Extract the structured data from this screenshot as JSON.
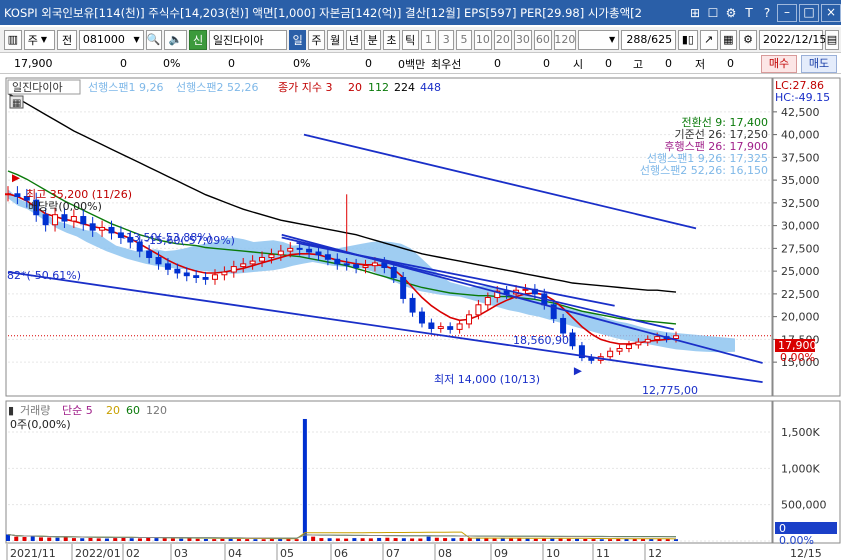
{
  "window": {
    "title": "KOSPI 외국인보유[114(천)] 주식수[14,203(천)] 액면[1,000] 자본금[142(억)] 결산[12월] EPS[597] PER[29.98] 시가총액[2",
    "buttons": [
      "⊞",
      "☐",
      "⚙",
      "T",
      "?",
      "–",
      "□",
      "×"
    ]
  },
  "toolbar": {
    "period_select": "주",
    "prev_label": "전",
    "stock_code": "081000",
    "stock_name": "일진다이아",
    "period_tabs": [
      "일",
      "주",
      "월",
      "년",
      "분",
      "초",
      "틱"
    ],
    "active_tab": "일",
    "intervals": [
      "1",
      "3",
      "5",
      "10",
      "20",
      "30",
      "60",
      "120"
    ],
    "count": "288/625",
    "date": "2022/12/15"
  },
  "quote": {
    "price": "17,900",
    "change": "0",
    "change_pct": "0%",
    "volume": "0",
    "volume_pct": "0%",
    "amount": "0",
    "amount_pct": "0%",
    "value": "0백만",
    "priority_label": "최우선",
    "ask": "0",
    "bid": "0",
    "open_label": "시",
    "open": "0",
    "high_label": "고",
    "high": "0",
    "low_label": "저",
    "low": "0",
    "buy_label": "매수",
    "sell_label": "매도"
  },
  "colors": {
    "up": "#e00000",
    "down": "#0030d0",
    "cloud": "#8ec4f0",
    "ma_black": "#000000",
    "ma_green": "#0a7a0a",
    "trend": "#1a2fc8"
  },
  "chart_data": {
    "type": "candlestick",
    "price_panel": {
      "name_label": "일진다이아",
      "legend": [
        {
          "text": "선행스팬1 9,26",
          "color": "#7fb8e8"
        },
        {
          "text": "선행스팬2 52,26",
          "color": "#7fb8e8"
        },
        {
          "text": "종가 지수 3",
          "color": "#c00000"
        },
        {
          "text": "20",
          "color": "#c00000"
        },
        {
          "text": "112",
          "color": "#0a7a0a"
        },
        {
          "text": "224",
          "color": "#000000"
        },
        {
          "text": "448",
          "color": "#1a2fc8"
        }
      ],
      "lc_label": "LC:27.86",
      "hc_label": "HC:-49.15",
      "ylim": [
        11500,
        46000
      ],
      "y_ticks": [
        "42,500",
        "40,000",
        "37,500",
        "35,000",
        "32,500",
        "30,000",
        "27,500",
        "25,000",
        "22,500",
        "20,000",
        "17,500",
        "15,000"
      ],
      "y_tick_values": [
        42500,
        40000,
        37500,
        35000,
        32500,
        30000,
        27500,
        25000,
        22500,
        20000,
        17500,
        15000
      ],
      "current_price_label": "17,900",
      "current_change_label": "0.00%",
      "current_price": 17900,
      "ichimoku_values": [
        {
          "label": "전환선 9: 17,400",
          "color": "#0a7a0a"
        },
        {
          "label": "기준선 26: 17,250",
          "color": "#333333"
        },
        {
          "label": "후행스팬 26: 17,900",
          "color": "#a0208a"
        },
        {
          "label": "선행스팬1 9,26: 17,325",
          "color": "#7fb8e8"
        },
        {
          "label": "선행스팬2 52,26: 16,150",
          "color": "#7fb8e8"
        }
      ],
      "annotations": {
        "high": "최고 35,200 (11/26)",
        "high_value": 35200,
        "dividend": "배당락(0,00%)",
        "low": "최저 14,000 (10/13)",
        "low_value": 14000,
        "left_pct": "82*(-50,61%)",
        "fall_1": "-13,50(-53,88%)",
        "fall_2": "-15,60(-57,09%)",
        "mid_value": "18,560,90",
        "channel_end": "12,775,00"
      },
      "close_series": [
        33500,
        33200,
        32800,
        31200,
        30100,
        31200,
        30500,
        31000,
        30200,
        29500,
        29800,
        29200,
        28700,
        28200,
        27200,
        26500,
        25800,
        25200,
        24800,
        24500,
        24300,
        24100,
        24600,
        24900,
        25500,
        25800,
        26100,
        26500,
        26800,
        27200,
        27500,
        27400,
        27100,
        26800,
        26300,
        25800,
        25700,
        25400,
        25600,
        25900,
        25400,
        24300,
        22000,
        20500,
        19300,
        18700,
        18900,
        18600,
        19200,
        20200,
        21300,
        22100,
        22800,
        22500,
        22900,
        23000,
        22500,
        21300,
        19800,
        18200,
        16800,
        15500,
        15200,
        15600,
        16200,
        16500,
        16900,
        17200,
        17500,
        17800,
        17600,
        17900
      ],
      "ma20": [
        33500,
        33200,
        32700,
        32000,
        31300,
        31000,
        30700,
        30500,
        30200,
        29900,
        29700,
        29400,
        29000,
        28600,
        28000,
        27400,
        26800,
        26200,
        25700,
        25300,
        25000,
        24800,
        24800,
        24900,
        25100,
        25300,
        25600,
        25900,
        26200,
        26500,
        26800,
        26900,
        26900,
        26800,
        26500,
        26200,
        26000,
        25800,
        25700,
        25700,
        25600,
        25200,
        24300,
        23200,
        22100,
        21200,
        20500,
        19900,
        19600,
        19700,
        20100,
        20700,
        21300,
        21800,
        22200,
        22500,
        22600,
        22400,
        21800,
        20900,
        19900,
        18900,
        18100,
        17500,
        17200,
        17000,
        17000,
        17100,
        17300,
        17400,
        17500,
        17600
      ],
      "ma112": [
        36000,
        35600,
        35100,
        34500,
        33900,
        33300,
        32700,
        32200,
        31700,
        31200,
        30700,
        30200,
        29800,
        29400,
        29000,
        28700,
        28400,
        28200,
        28000,
        27900,
        27800,
        27600,
        27500,
        27400,
        27300,
        27200,
        27100,
        27000,
        26900,
        26800,
        26700,
        26600,
        26400,
        26200,
        26000,
        25800,
        25600,
        25300,
        25000,
        24700,
        24400,
        24100,
        23800,
        23500,
        23200,
        23000,
        22800,
        22600,
        22500,
        22400,
        22300,
        22300,
        22200,
        22200,
        22100,
        22000,
        21900,
        21700,
        21500,
        21200,
        20900,
        20600,
        20400,
        20200,
        20000,
        19800,
        19700,
        19600,
        19500,
        19400,
        19300,
        19200
      ],
      "ma224": [
        44500,
        44000,
        43400,
        42800,
        42200,
        41600,
        41000,
        40400,
        39900,
        39400,
        38900,
        38400,
        37900,
        37400,
        36900,
        36400,
        35900,
        35400,
        34900,
        34400,
        33900,
        33400,
        33000,
        32600,
        32200,
        31800,
        31500,
        31200,
        30900,
        30600,
        30400,
        30200,
        30000,
        29800,
        29600,
        29400,
        29200,
        29000,
        28700,
        28400,
        28100,
        27800,
        27500,
        27200,
        26900,
        26700,
        26500,
        26300,
        26100,
        25900,
        25700,
        25500,
        25300,
        25100,
        24900,
        24700,
        24500,
        24300,
        24100,
        23900,
        23700,
        23600,
        23500,
        23400,
        23300,
        23200,
        23100,
        23000,
        22900,
        22900,
        22800,
        22700
      ],
      "cloud_upper": [
        34000,
        33000,
        32500,
        31800,
        31200,
        30500,
        30200,
        29800,
        29500,
        29300,
        28500,
        27800,
        27500,
        27200,
        27300,
        27400,
        27200,
        27300,
        27500,
        27800,
        28000,
        28200,
        28600,
        28700,
        28500,
        28200,
        28300,
        28400,
        28200,
        27800,
        27900,
        28000,
        27600,
        27400,
        27600,
        27800,
        28000,
        28200,
        28300,
        28200,
        28000,
        27500,
        26500,
        25500,
        24500,
        23800,
        23500,
        23200,
        23400,
        23300,
        23000,
        22800,
        22600,
        22300,
        21800,
        21500,
        21300,
        21000,
        20800,
        20500,
        20200,
        19800,
        19500,
        19300,
        19000,
        18700,
        18500,
        18300,
        18200,
        18100,
        18000,
        17900,
        17800,
        17700,
        17600
      ],
      "cloud_lower": [
        33000,
        32200,
        31800,
        31100,
        30400,
        29700,
        29200,
        28800,
        28200,
        27700,
        27200,
        26800,
        26400,
        26100,
        25800,
        25600,
        25400,
        25300,
        25200,
        25100,
        25000,
        24900,
        24800,
        24700,
        24800,
        24900,
        25000,
        25100,
        25300,
        25600,
        25800,
        26000,
        25800,
        25600,
        25500,
        25400,
        25300,
        25000,
        24500,
        24000,
        23500,
        23100,
        22800,
        22600,
        22400,
        22300,
        22200,
        21900,
        21600,
        21300,
        21000,
        20700,
        20500,
        20200,
        20000,
        19700,
        19400,
        19100,
        18800,
        18500,
        18200,
        17900,
        17600,
        17400,
        17200,
        17000,
        16800,
        16600,
        16400,
        16300,
        16200,
        16150,
        16100,
        16100,
        16150
      ],
      "trend_lines": [
        {
          "from": [
            0,
            24900
          ],
          "to": [
            102,
            12800
          ]
        },
        {
          "from": [
            37,
            28700
          ],
          "to": [
            90,
            18600
          ]
        },
        {
          "from": [
            37,
            29000
          ],
          "to": [
            102,
            14900
          ]
        },
        {
          "from": [
            39,
            28100
          ],
          "to": [
            82,
            21200
          ]
        },
        {
          "from": [
            40,
            40000
          ],
          "to": [
            93,
            29700
          ]
        }
      ]
    },
    "volume_panel": {
      "legend": [
        {
          "text": "거래량",
          "color": "#7a7a7a"
        },
        {
          "text": "단순 5",
          "color": "#a0208a"
        },
        {
          "text": "20",
          "color": "#c8a000"
        },
        {
          "text": "60",
          "color": "#0a7a0a"
        },
        {
          "text": "120",
          "color": "#777777"
        }
      ],
      "value_label": "0주(0,00%)",
      "ylim": [
        0,
        1900000
      ],
      "y_ticks": [
        "1,500K",
        "1,000K",
        "500,000",
        "0"
      ],
      "y_tick_values": [
        1500000,
        1000000,
        500000,
        0
      ],
      "current_label": "0",
      "current_pct": "0.00%",
      "values": [
        90000,
        60000,
        55000,
        70000,
        50000,
        48000,
        45000,
        52000,
        40000,
        38000,
        42000,
        36000,
        34000,
        40000,
        45000,
        38000,
        36000,
        52000,
        40000,
        38000,
        35000,
        32000,
        36000,
        30000,
        28000,
        26000,
        30000,
        32000,
        28000,
        26000,
        25000,
        24000,
        27000,
        30000,
        28000,
        25000,
        1680000,
        60000,
        40000,
        38000,
        35000,
        33000,
        40000,
        38000,
        36000,
        42000,
        45000,
        40000,
        38000,
        35000,
        34000,
        60000,
        45000,
        40000,
        38000,
        42000,
        40000,
        37000,
        35000,
        33000,
        36000,
        38000,
        35000,
        33000,
        30000,
        32000,
        35000,
        34000,
        31000,
        30000,
        28000,
        26000,
        24000,
        25000,
        27000,
        28000,
        30000,
        32000,
        30000,
        28000,
        26000,
        25000
      ]
    },
    "x_axis": {
      "labels": [
        "2021/11",
        "2022/01",
        "02",
        "03",
        "04",
        "05",
        "06",
        "07",
        "08",
        "09",
        "10",
        "11",
        "12",
        "12/15"
      ]
    }
  }
}
